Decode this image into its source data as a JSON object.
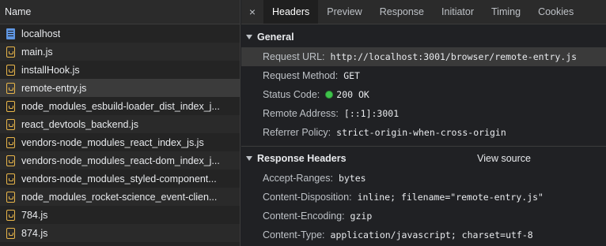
{
  "list": {
    "header": "Name",
    "items": [
      {
        "name": "localhost",
        "icon": "document-icon"
      },
      {
        "name": "main.js",
        "icon": "js-file-icon"
      },
      {
        "name": "installHook.js",
        "icon": "js-file-icon"
      },
      {
        "name": "remote-entry.js",
        "icon": "js-file-icon",
        "selected": true
      },
      {
        "name": "node_modules_esbuild-loader_dist_index_j...",
        "icon": "js-file-icon"
      },
      {
        "name": "react_devtools_backend.js",
        "icon": "js-file-icon"
      },
      {
        "name": "vendors-node_modules_react_index_js.js",
        "icon": "js-file-icon"
      },
      {
        "name": "vendors-node_modules_react-dom_index_j...",
        "icon": "js-file-icon"
      },
      {
        "name": "vendors-node_modules_styled-component...",
        "icon": "js-file-icon"
      },
      {
        "name": "node_modules_rocket-science_event-clien...",
        "icon": "js-file-icon"
      },
      {
        "name": "784.js",
        "icon": "js-file-icon"
      },
      {
        "name": "874.js",
        "icon": "js-file-icon"
      }
    ]
  },
  "tabs": {
    "close": "×",
    "items": [
      "Headers",
      "Preview",
      "Response",
      "Initiator",
      "Timing",
      "Cookies"
    ],
    "active": "Headers"
  },
  "general": {
    "title": "General",
    "request_url_key": "Request URL:",
    "request_url": "http://localhost:3001/browser/remote-entry.js",
    "request_method_key": "Request Method:",
    "request_method": "GET",
    "status_code_key": "Status Code:",
    "status_code": "200 OK",
    "status_color": "#3fc34b",
    "remote_address_key": "Remote Address:",
    "remote_address": "[::1]:3001",
    "referrer_policy_key": "Referrer Policy:",
    "referrer_policy": "strict-origin-when-cross-origin"
  },
  "response_headers": {
    "title": "Response Headers",
    "view_source": "View source",
    "items": [
      {
        "key": "Accept-Ranges:",
        "value": "bytes"
      },
      {
        "key": "Content-Disposition:",
        "value": "inline; filename=\"remote-entry.js\""
      },
      {
        "key": "Content-Encoding:",
        "value": "gzip"
      },
      {
        "key": "Content-Type:",
        "value": "application/javascript; charset=utf-8"
      }
    ]
  }
}
